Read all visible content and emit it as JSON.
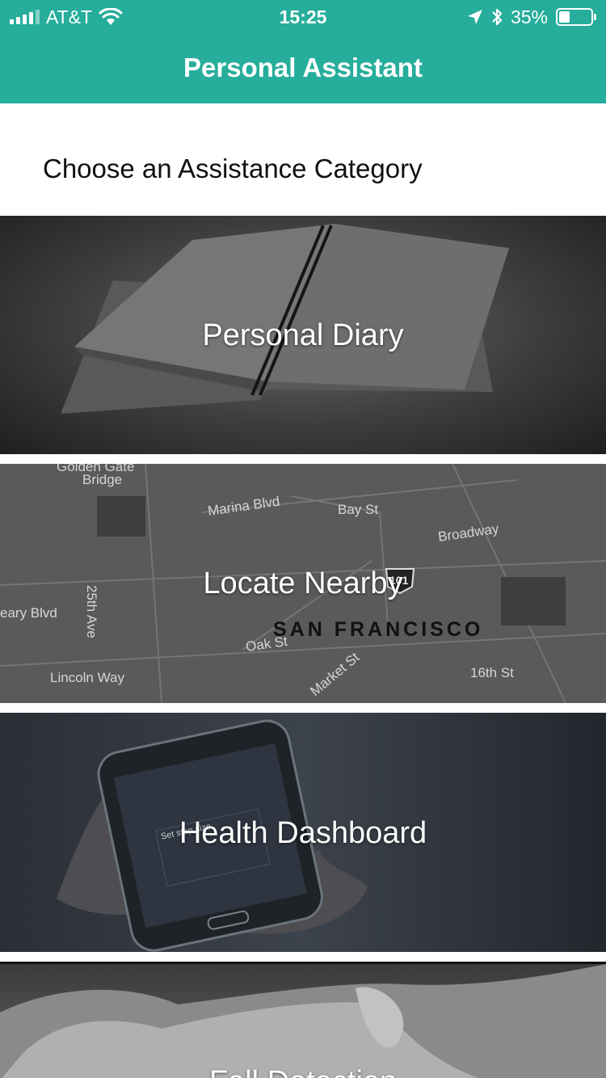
{
  "status_bar": {
    "carrier": "AT&T",
    "time": "15:25",
    "battery": "35%",
    "battery_level": 0.35,
    "icons": [
      "signal-icon",
      "wifi-icon",
      "location-arrow-icon",
      "bluetooth-icon",
      "battery-icon"
    ]
  },
  "header": {
    "title": "Personal Assistant",
    "background": "#26ad9b"
  },
  "subtitle": "Choose an Assistance Category",
  "categories": [
    {
      "label": "Personal Diary",
      "image": "notebook-photo"
    },
    {
      "label": "Locate Nearby",
      "image": "map-photo"
    },
    {
      "label": "Health Dashboard",
      "image": "smartphone-photo"
    },
    {
      "label": "Fall Detection",
      "image": "fallen-person-photo"
    }
  ],
  "map_labels": {
    "golden_gate": "Golden Gate",
    "bridge": "Bridge",
    "marina": "Marina Blvd",
    "bay": "Bay St",
    "broadway": "Broadway",
    "highway": "101",
    "geary": "eary Blvd",
    "ave25": "25th Ave",
    "sf": "SAN FRANCISCO",
    "oak": "Oak St",
    "lincoln": "Lincoln Way",
    "market": "Market St",
    "st16": "16th St"
  },
  "phone_screen": {
    "step_label": "Set step size"
  }
}
